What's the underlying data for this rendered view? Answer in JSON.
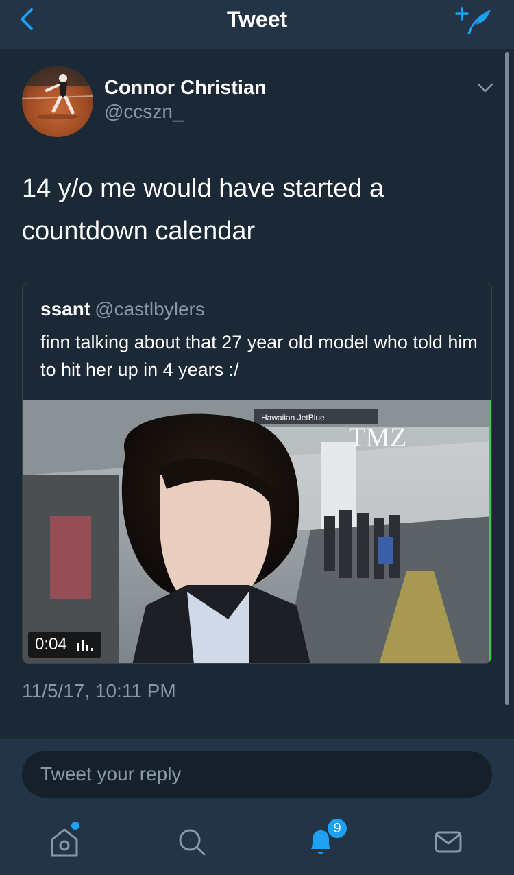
{
  "header": {
    "title": "Tweet",
    "back_icon": "chevron-left-icon",
    "compose_icon": "compose-quill-icon"
  },
  "tweet": {
    "author_name": "Connor Christian",
    "author_handle": "@ccszn_",
    "text": "14 y/o me would have started a countdown calendar",
    "timestamp": "11/5/17, 10:11 PM",
    "more_icon": "chevron-down-icon"
  },
  "quoted_tweet": {
    "author_name": "ssant",
    "author_handle": "@castlbylers",
    "text": "finn talking about that 27 year old model who told him to hit her up in 4 years :/",
    "video": {
      "duration": "0:04",
      "watermark": "TMZ",
      "signage": "Hawaiian  JetBlue"
    }
  },
  "reply": {
    "placeholder": "Tweet your reply"
  },
  "tabbar": {
    "notifications_count": "9",
    "tabs": [
      "home-icon",
      "search-icon",
      "bell-icon",
      "mail-icon"
    ]
  },
  "colors": {
    "background": "#1b2836",
    "bar": "#243447",
    "accent": "#1da1f2",
    "secondary_text": "#8899a6"
  }
}
